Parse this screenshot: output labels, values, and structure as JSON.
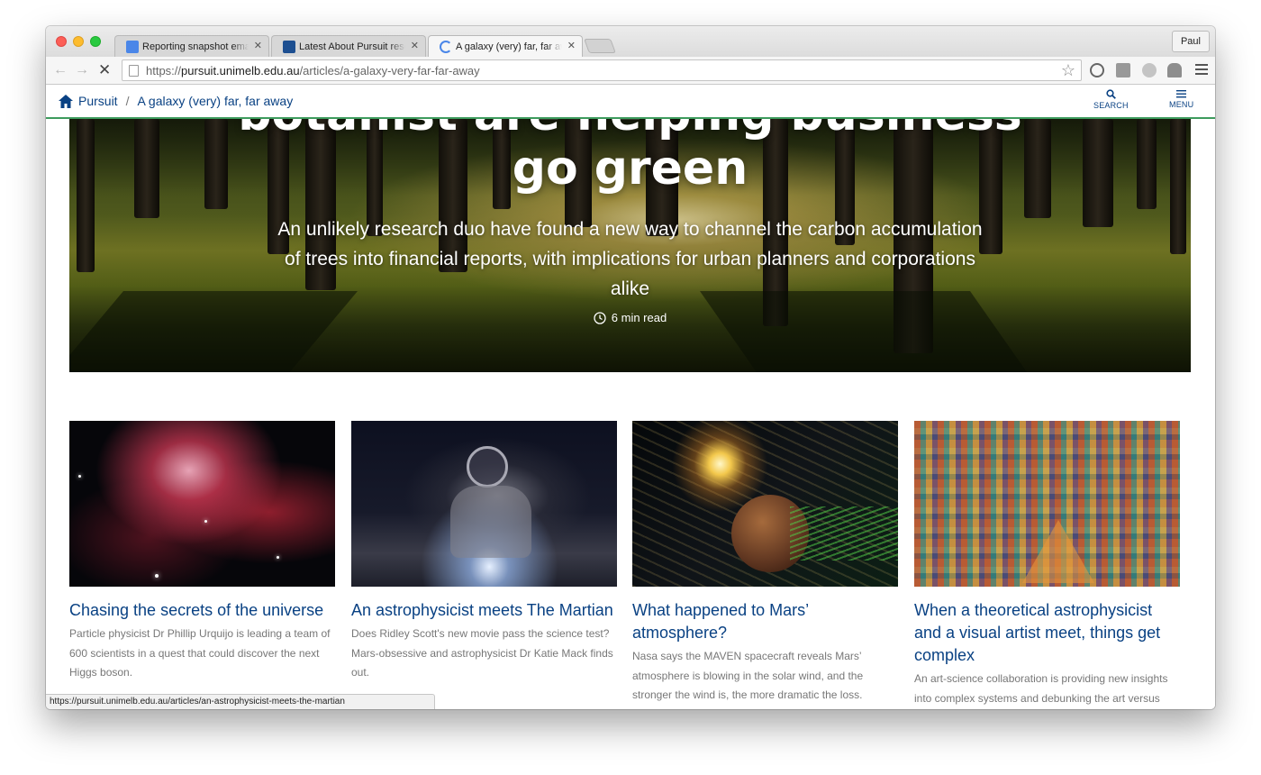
{
  "browser": {
    "tabs": [
      {
        "title": "Reporting snapshot emails",
        "favicon_color": "#4a86e8"
      },
      {
        "title": "Latest About Pursuit research",
        "favicon_color": "#1d4f91"
      },
      {
        "title": "A galaxy (very) far, far away",
        "favicon_color": "#4a86e8"
      }
    ],
    "profile_name": "Paul",
    "url": {
      "scheme": "https://",
      "host": "pursuit.unimelb.edu.au",
      "path": "/articles/a-galaxy-very-far-far-away"
    },
    "status_url": "https://pursuit.unimelb.edu.au/articles/an-astrophysicist-meets-the-martian"
  },
  "site": {
    "breadcrumb": {
      "home": "Pursuit",
      "separator": "/",
      "current": "A galaxy (very) far, far away"
    },
    "search_label": "SEARCH",
    "menu_label": "MENU",
    "accent_color": "#3d9b5d",
    "link_color": "#094183"
  },
  "hero": {
    "title_line1": "botanist are helping business",
    "title_line2": "go green",
    "subtitle": "An unlikely research duo have found a new way to channel the carbon accumulation of trees into financial reports, with implications for urban planners and corporations alike",
    "read_time": "6 min read"
  },
  "articles": [
    {
      "title": "Chasing the secrets of the universe",
      "summary": "Particle physicist Dr Phillip Urquijo is leading a team of 600 scientists in a quest that could discover the next Higgs boson.",
      "image": "nebula-image"
    },
    {
      "title": "An astrophysicist meets The Martian",
      "summary": "Does Ridley Scott's new movie pass the science test? Mars-obsessive and astrophysicist Dr Katie Mack finds out.",
      "image": "astronaut-image"
    },
    {
      "title": "What happened to Mars’ atmosphere?",
      "summary": "Nasa says the MAVEN spacecraft reveals Mars’ atmosphere is blowing in the solar wind, and the stronger the wind is, the more dramatic the loss.",
      "image": "mars-solar-wind-image"
    },
    {
      "title": "When a theoretical astrophysicist and a visual artist meet, things get complex",
      "summary": "An art-science collaboration is providing new insights into complex systems and debunking the art versus",
      "image": "abstract-art-image"
    }
  ]
}
